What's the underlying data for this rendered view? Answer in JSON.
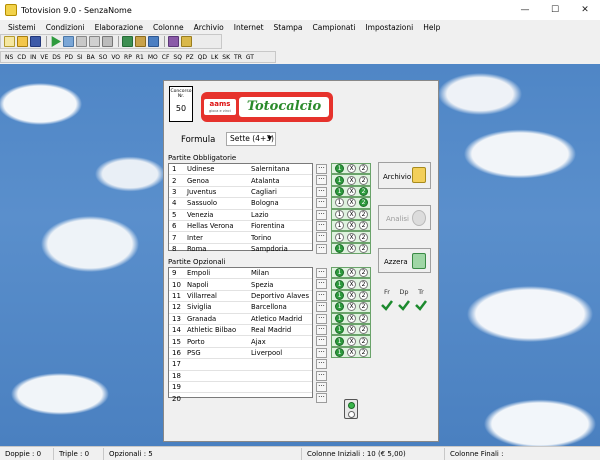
{
  "window": {
    "title": "Totovision 9.0 - SenzaNome"
  },
  "menu": [
    "Sistemi",
    "Condizioni",
    "Elaborazione",
    "Colonne",
    "Archivio",
    "Internet",
    "Stampa",
    "Campionati",
    "Impostazioni",
    "Help"
  ],
  "leagues": [
    "NS",
    "CD",
    "IN",
    "VE",
    "DS",
    "PD",
    "SI",
    "BA",
    "SO",
    "VO",
    "RP",
    "R1",
    "MO",
    "CF",
    "SQ",
    "PZ",
    "QD",
    "LK",
    "SK",
    "TR",
    "GT"
  ],
  "concorso": {
    "label": "Concorso Nr.",
    "number": "50"
  },
  "logo": {
    "small": "aams",
    "small_sub": "gioca e vinci",
    "main": "Totocalcio"
  },
  "formula": {
    "label": "Formula",
    "value": "Sette (4+3)"
  },
  "obbligatorie": {
    "label": "Partite Obbligatorie",
    "rows": [
      {
        "n": "1",
        "home": "Udinese",
        "away": "Salernitana"
      },
      {
        "n": "2",
        "home": "Genoa",
        "away": "Atalanta"
      },
      {
        "n": "3",
        "home": "Juventus",
        "away": "Cagliari"
      },
      {
        "n": "4",
        "home": "Sassuolo",
        "away": "Bologna"
      },
      {
        "n": "5",
        "home": "Venezia",
        "away": "Lazio"
      },
      {
        "n": "6",
        "home": "Hellas Verona",
        "away": "Fiorentina"
      },
      {
        "n": "7",
        "home": "Inter",
        "away": "Torino"
      },
      {
        "n": "8",
        "home": "Roma",
        "away": "Sampdoria"
      }
    ]
  },
  "opzionali": {
    "label": "Partite Opzionali",
    "rows": [
      {
        "n": "9",
        "home": "Empoli",
        "away": "Milan"
      },
      {
        "n": "10",
        "home": "Napoli",
        "away": "Spezia"
      },
      {
        "n": "11",
        "home": "Villarreal",
        "away": "Deportivo Alaves"
      },
      {
        "n": "12",
        "home": "Siviglia",
        "away": "Barcellona"
      },
      {
        "n": "13",
        "home": "Granada",
        "away": "Atletico Madrid"
      },
      {
        "n": "14",
        "home": "Athletic Bilbao",
        "away": "Real Madrid"
      },
      {
        "n": "15",
        "home": "Porto",
        "away": "Ajax"
      },
      {
        "n": "16",
        "home": "PSG",
        "away": "Liverpool"
      },
      {
        "n": "17",
        "home": "",
        "away": ""
      },
      {
        "n": "18",
        "home": "",
        "away": ""
      },
      {
        "n": "19",
        "home": "",
        "away": ""
      },
      {
        "n": "20",
        "home": "",
        "away": ""
      }
    ]
  },
  "sign_labels": [
    "1",
    "X",
    "2"
  ],
  "signs_obbligatorie": [
    [
      true,
      false,
      false
    ],
    [
      true,
      false,
      false
    ],
    [
      true,
      false,
      true
    ],
    [
      false,
      false,
      true
    ],
    [
      false,
      false,
      false
    ],
    [
      false,
      false,
      false
    ],
    [
      false,
      false,
      false
    ],
    [
      true,
      false,
      false
    ]
  ],
  "signs_opzionali": [
    [
      true,
      false,
      false
    ],
    [
      true,
      false,
      false
    ],
    [
      true,
      false,
      false
    ],
    [
      true,
      false,
      false
    ],
    [
      true,
      false,
      false
    ],
    [
      true,
      false,
      false
    ],
    [
      true,
      false,
      false
    ],
    [
      true,
      false,
      false
    ]
  ],
  "more_label": "···",
  "buttons": {
    "archivio": "Archivio",
    "analisi": "Analisi",
    "azzera": "Azzera"
  },
  "filters": {
    "fr": "Fr",
    "dp": "Dp",
    "tr": "Tr"
  },
  "status": {
    "doppie": "Doppie : 0",
    "triple": "Triple : 0",
    "opzionali": "Opzionali : 5",
    "colonne_iniziali": "Colonne Iniziali : 10 (€ 5,00)",
    "colonne_finali": "Colonne Finali :"
  },
  "colors": {
    "accent_green": "#2e9b3e",
    "logo_red": "#e6322c",
    "sky": "#4f86c6"
  }
}
